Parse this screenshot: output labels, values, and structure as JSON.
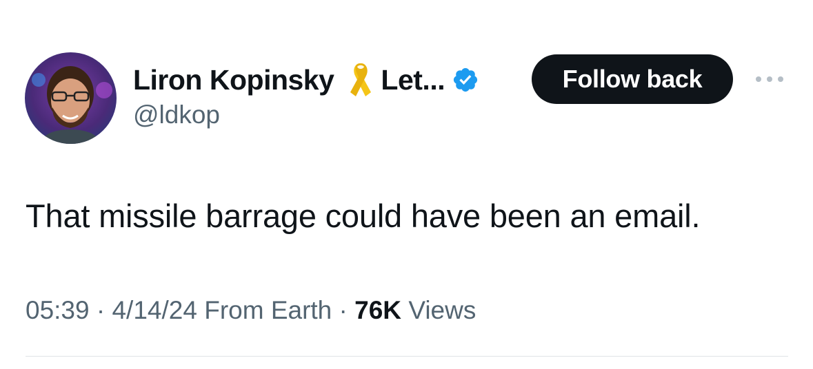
{
  "author": {
    "display_name": "Liron Kopinsky",
    "name_suffix": "Let...",
    "handle": "@ldkop",
    "icons": [
      "yellow-ribbon-icon",
      "verified-badge-icon"
    ]
  },
  "follow_button": {
    "label": "Follow back"
  },
  "more_menu": {
    "icon": "more-dots-icon"
  },
  "tweet": {
    "text": "That missile barrage could have been an email.",
    "time": "05:39",
    "separator": " · ",
    "date": "4/14/24",
    "source": "From Earth",
    "views_count": "76K",
    "views_label": "Views"
  },
  "colors": {
    "text_primary": "#0f1419",
    "text_secondary": "#536471",
    "button_bg": "#0f1419",
    "verified_blue": "#1d9bf0",
    "ribbon_yellow": "#f5c518"
  }
}
